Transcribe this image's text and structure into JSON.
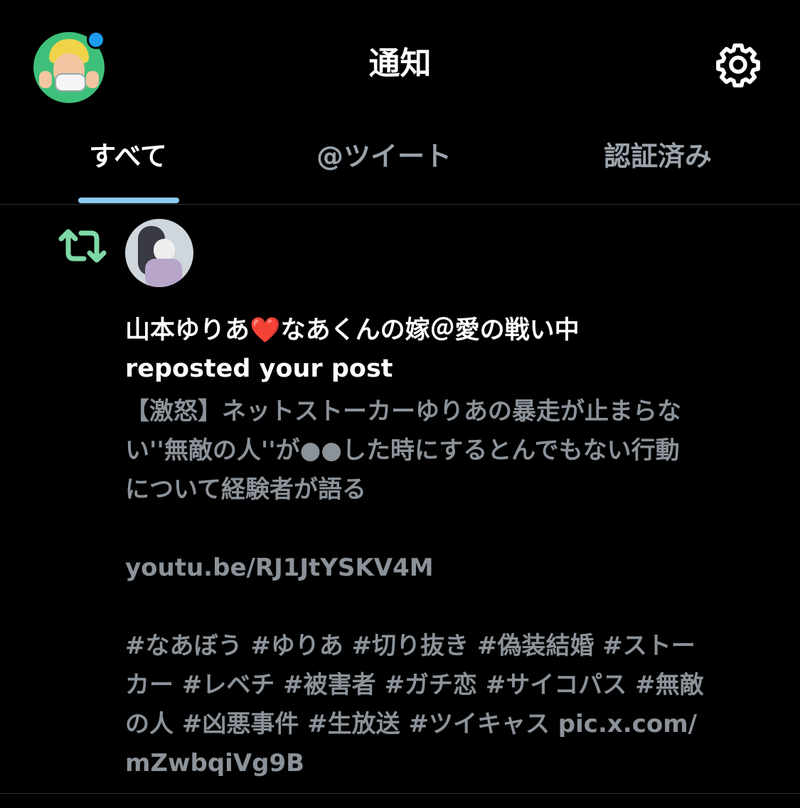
{
  "header": {
    "title": "通知"
  },
  "tabs": [
    {
      "label": "すべて"
    },
    {
      "label": "@ツイート"
    },
    {
      "label": "認証済み"
    }
  ],
  "notification": {
    "user_name": "山本ゆりあ❤️なあくんの嫁＠愛の戦い中",
    "action": "reposted your post",
    "text_lines": [
      "【激怒】ネットストーカーゆりあの暴走が止まらな",
      "い''無敵の人''が●●した時にするとんでもない行動",
      "について経験者が語る"
    ],
    "link": "youtu.be/RJ1JtYSKV4M",
    "hashtag_lines": [
      "#なあぼう #ゆりあ #切り抜き #偽装結婚 #ストー",
      "カー #レベチ #被害者 #ガチ恋 #サイコパス #無敵",
      "の人 #凶悪事件 #生放送 #ツイキャス pic.x.com/",
      "mZwbqiVg9B"
    ]
  },
  "colors": {
    "background": "#000000",
    "text_primary": "#ffffff",
    "text_secondary": "#8b9299",
    "accent_blue": "#1d9bf0",
    "retweet_green": "#7ed8a6"
  }
}
